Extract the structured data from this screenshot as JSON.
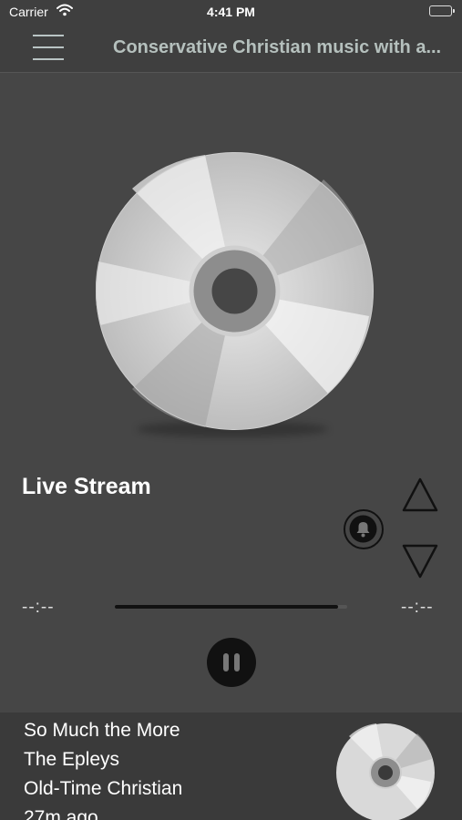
{
  "status_bar": {
    "carrier": "Carrier",
    "time": "4:41 PM",
    "icons": [
      "wifi-icon",
      "battery-icon"
    ]
  },
  "nav": {
    "menu_icon": "hamburger-menu-icon",
    "title": "Conservative Christian music with a..."
  },
  "player": {
    "artwork_icon": "cd-disc-icon",
    "title": "Live Stream",
    "elapsed": "--:--",
    "remaining": "--:--",
    "progress": 0.96,
    "controls": {
      "alarm_icon": "bell-icon",
      "up_icon": "triangle-up-icon",
      "down_icon": "triangle-down-icon",
      "pause_icon": "pause-icon"
    }
  },
  "now_playing": {
    "song": "So Much the More",
    "artist": "The Epleys",
    "album": "Old-Time Christian",
    "played_ago": "27m ago",
    "thumb_icon": "cd-disc-icon"
  },
  "colors": {
    "background": "#464646",
    "bar": "#3f3f3f",
    "nav_title": "#b5c0bd",
    "accent_dark": "#111111"
  }
}
